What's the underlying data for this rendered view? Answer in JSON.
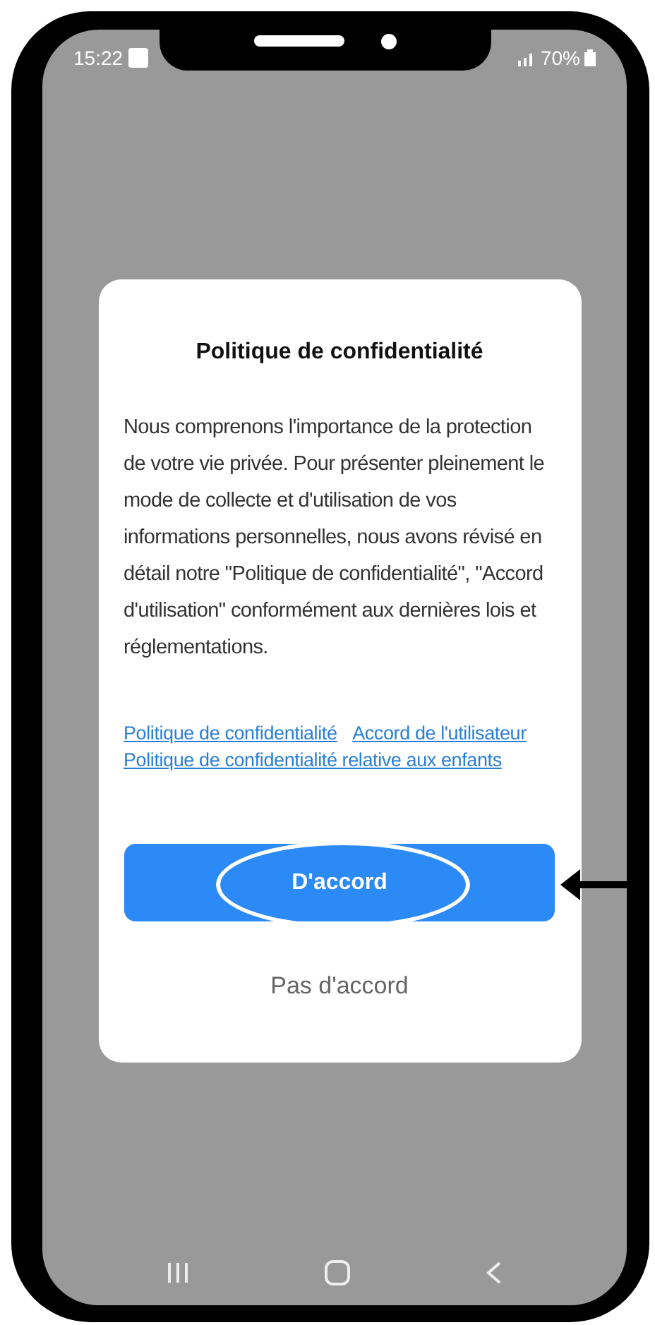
{
  "status_bar": {
    "time": "15:22",
    "battery": "70%"
  },
  "dialog": {
    "title": "Politique de confidentialité",
    "body": "Nous comprenons l'importance de la protection de votre vie privée. Pour présenter pleinement le mode de collecte et d'utilisation de vos informations personnelles, nous avons révisé en détail notre \"Politique de confidentialité\", \"Accord d'utilisation\" conformément aux dernières lois et réglementations.",
    "links": [
      "Politique de confidentialité",
      "Accord de l'utilisateur",
      "Politique de confidentialité relative aux enfants"
    ],
    "buttons": [
      {
        "kind": "primary",
        "label": "D'accord",
        "highlighted": true
      },
      {
        "kind": "text",
        "label": "Pas d'accord",
        "highlighted": false
      }
    ]
  }
}
